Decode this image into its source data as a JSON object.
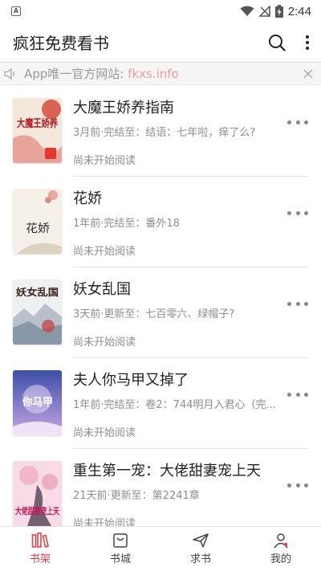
{
  "status_bar": {
    "time": "2:44"
  },
  "app_bar": {
    "title": "疯狂免费看书"
  },
  "notice": {
    "text": "App唯一官方网站: ",
    "link": "fkxs.info"
  },
  "books": [
    {
      "title": "大魔王娇养指南",
      "meta": "3月前·完结至：结语：七年啦，痒了么?",
      "status": "尚未开始阅读",
      "cover_text": "大魔王娇养"
    },
    {
      "title": "花娇",
      "meta": "1年前·完结至：番外18",
      "status": "尚未开始阅读",
      "cover_text": "花娇"
    },
    {
      "title": "妖女乱国",
      "meta": "3天前·更新至：七百零六、绿帽子?",
      "status": "尚未开始阅读",
      "cover_text": "妖女乱国"
    },
    {
      "title": "夫人你马甲又掉了",
      "meta": "1年前·完结至：卷2：744明月入君心（完...",
      "status": "尚未开始阅读",
      "cover_text": "你马甲"
    },
    {
      "title": "重生第一宠：大佬甜妻宠上天",
      "meta": "21天前·更新至：第2241章",
      "status": "尚未开始阅读",
      "cover_text": "大佬甜妻宠上天"
    }
  ],
  "nav": [
    {
      "label": "书架",
      "icon": "bookshelf-icon"
    },
    {
      "label": "书城",
      "icon": "store-icon"
    },
    {
      "label": "求书",
      "icon": "send-icon"
    },
    {
      "label": "我的",
      "icon": "profile-icon"
    }
  ],
  "colors": {
    "accent": "#e0414a",
    "link": "#f29ca0",
    "text_secondary": "#8e8e8e"
  }
}
